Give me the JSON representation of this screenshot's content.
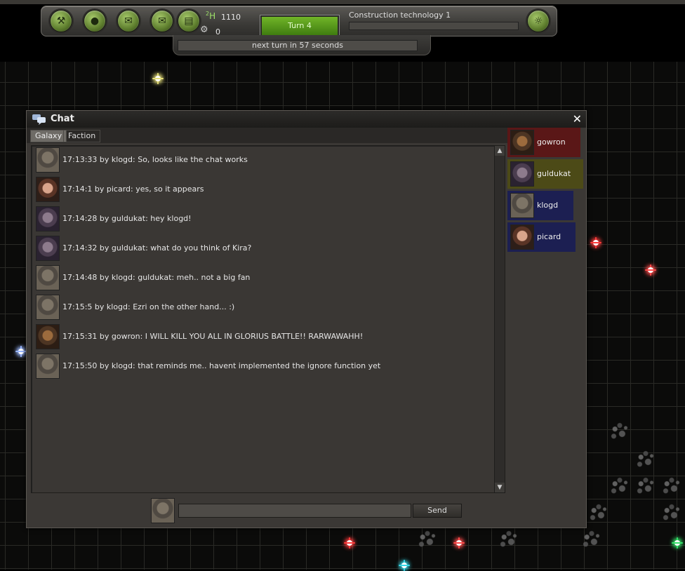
{
  "hud": {
    "research_points": "1110",
    "research_icon_label": "2H",
    "production_points": "0",
    "turn_label": "Turn 4",
    "research_item": "Construction technology 1",
    "research_progress": 0,
    "next_turn_text": "next turn in 57 seconds",
    "buttons": [
      "wrench-icon",
      "planet-icon",
      "diplomacy-icon",
      "mail-icon",
      "book-icon"
    ],
    "right_button": "lightbulb-icon"
  },
  "chat": {
    "title": "Chat",
    "close_glyph": "✕",
    "tabs": [
      {
        "label": "Galaxy",
        "active": true
      },
      {
        "label": "Faction",
        "active": false
      }
    ],
    "messages": [
      {
        "avatar": "klogd",
        "text": "17:13:33 by klogd: So, looks like the chat works"
      },
      {
        "avatar": "picard",
        "text": "17:14:1 by picard: yes, so it appears"
      },
      {
        "avatar": "guldukat",
        "text": "17:14:28 by guldukat: hey klogd!"
      },
      {
        "avatar": "guldukat",
        "text": "17:14:32 by guldukat: what do you think of Kira?"
      },
      {
        "avatar": "klogd",
        "text": "17:14:48 by klogd: guldukat: meh.. not a big fan"
      },
      {
        "avatar": "klogd",
        "text": "17:15:5 by klogd: Ezri on the other hand... :)"
      },
      {
        "avatar": "gowron",
        "text": "17:15:31 by gowron: I WILL KILL YOU ALL IN GLORIUS BATTLE!! RARWAWAHH!"
      },
      {
        "avatar": "klogd",
        "text": "17:15:50 by klogd: that reminds me.. havent implemented the ignore function yet"
      }
    ],
    "users": [
      {
        "name": "gowron",
        "avatar": "gowron",
        "color": "#5a1717"
      },
      {
        "name": "guldukat",
        "avatar": "guldukat",
        "color": "#4c4a17"
      },
      {
        "name": "klogd",
        "avatar": "klogd",
        "color": "#1c1f52"
      },
      {
        "name": "picard",
        "avatar": "picard",
        "color": "#1c1f52"
      }
    ],
    "input_value": "",
    "send_label": "Send"
  }
}
